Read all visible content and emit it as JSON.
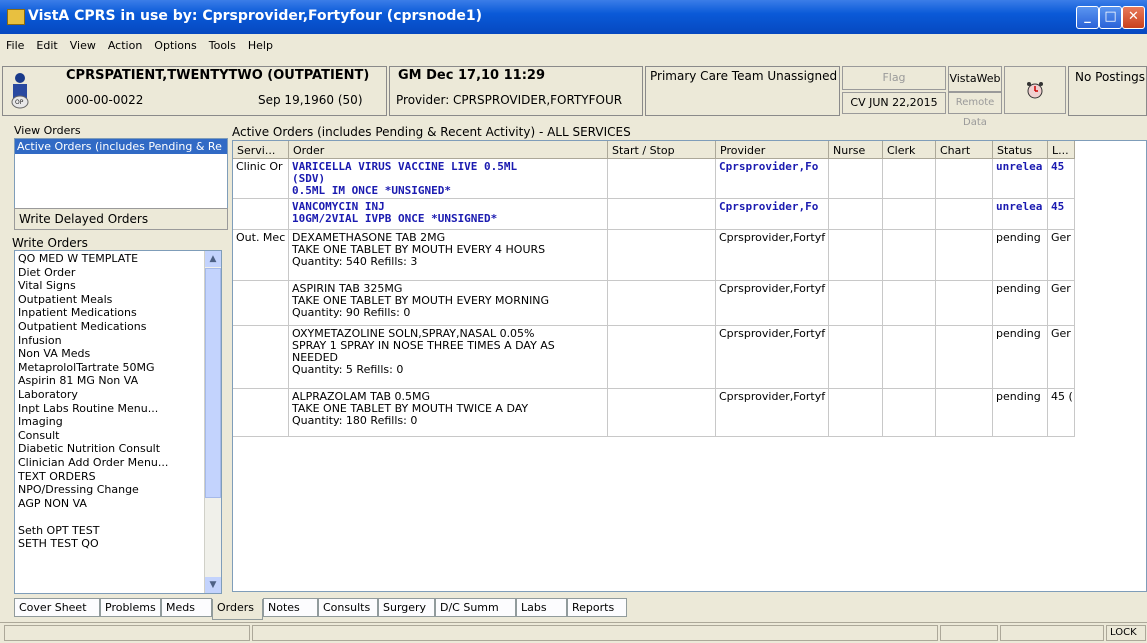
{
  "window": {
    "title": "VistA CPRS in use by: Cprsprovider,Fortyfour  (cprsnode1)",
    "controls": [
      "minimize",
      "maximize",
      "close"
    ]
  },
  "menu": [
    "File",
    "Edit",
    "View",
    "Action",
    "Options",
    "Tools",
    "Help"
  ],
  "patient": {
    "name": "CPRSPATIENT,TWENTYTWO (OUTPATIENT)",
    "ssn": "000-00-0022",
    "dob": "Sep 19,1960 (50)"
  },
  "encounter": {
    "datetime": "GM Dec 17,10 11:29",
    "provider": "Provider:  CPRSPROVIDER,FORTYFOUR"
  },
  "care_team": "Primary Care Team Unassigned",
  "flag": {
    "label": "Flag",
    "cv": "CV JUN 22,2015"
  },
  "vistaweb": {
    "label": "VistaWeb",
    "remote": "Remote Data"
  },
  "postings": "No Postings",
  "view_orders": {
    "label": "View Orders",
    "selected": "Active Orders (includes Pending & Re"
  },
  "write_delayed": "Write Delayed Orders",
  "write_orders": {
    "label": "Write Orders",
    "items": [
      "QO MED W TEMPLATE",
      "Diet Order",
      "Vital Signs",
      "Outpatient Meals",
      "Inpatient Medications",
      "Outpatient Medications",
      "Infusion",
      "Non VA Meds",
      "MetaprololTartrate 50MG",
      "Aspirin 81 MG Non VA",
      "Laboratory",
      "Inpt Labs Routine Menu...",
      "Imaging",
      "Consult",
      "Diabetic Nutrition Consult",
      "Clinician Add Order Menu...",
      "TEXT ORDERS",
      "NPO/Dressing Change",
      "AGP NON VA",
      "",
      "Seth OPT TEST",
      "SETH TEST QO"
    ]
  },
  "orders": {
    "title": "Active Orders (includes Pending & Recent Activity) - ALL SERVICES",
    "columns": [
      "Servi...",
      "Order",
      "Start / Stop",
      "Provider",
      "Nurse",
      "Clerk",
      "Chart",
      "Status",
      "L..."
    ],
    "rows": [
      {
        "service": "Clinic Or",
        "order": [
          "VARICELLA VIRUS VACCINE LIVE 0.5ML",
          "(SDV)",
          "0.5ML IM ONCE *UNSIGNED*"
        ],
        "provider": "Cprsprovider,Fo",
        "status": "unrelea",
        "location": "45",
        "bold": true
      },
      {
        "service": "",
        "order": [
          "VANCOMYCIN INJ",
          "10GM/2VIAL IVPB ONCE *UNSIGNED*"
        ],
        "provider": "Cprsprovider,Fo",
        "status": "unrelea",
        "location": "45",
        "bold": true
      },
      {
        "service": "Out. Mec",
        "order": [
          "DEXAMETHASONE TAB 2MG",
          "TAKE ONE TABLET BY MOUTH EVERY 4 HOURS",
          "Quantity: 540 Refills: 3"
        ],
        "provider": "Cprsprovider,Fortyf",
        "status": "pending",
        "location": "Ger",
        "bold": false
      },
      {
        "service": "",
        "order": [
          "ASPIRIN TAB 325MG",
          "TAKE ONE TABLET BY MOUTH EVERY MORNING",
          "Quantity: 90 Refills: 0"
        ],
        "provider": "Cprsprovider,Fortyf",
        "status": "pending",
        "location": "Ger",
        "bold": false
      },
      {
        "service": "",
        "order": [
          "OXYMETAZOLINE SOLN,SPRAY,NASAL 0.05%",
          "SPRAY 1 SPRAY IN NOSE THREE TIMES A DAY AS",
          "NEEDED",
          "Quantity: 5 Refills: 0"
        ],
        "provider": "Cprsprovider,Fortyf",
        "status": "pending",
        "location": "Ger",
        "bold": false
      },
      {
        "service": "",
        "order": [
          "ALPRAZOLAM TAB 0.5MG",
          "TAKE ONE TABLET BY MOUTH TWICE A DAY",
          "Quantity: 180 Refills: 0"
        ],
        "provider": "Cprsprovider,Fortyf",
        "status": "pending",
        "location": "45 (",
        "bold": false
      }
    ]
  },
  "tabs": [
    "Cover Sheet",
    "Problems",
    "Meds",
    "Orders",
    "Notes",
    "Consults",
    "Surgery",
    "D/C Summ",
    "Labs",
    "Reports"
  ],
  "active_tab": "Orders",
  "status_bar": {
    "lock": "LOCK"
  }
}
